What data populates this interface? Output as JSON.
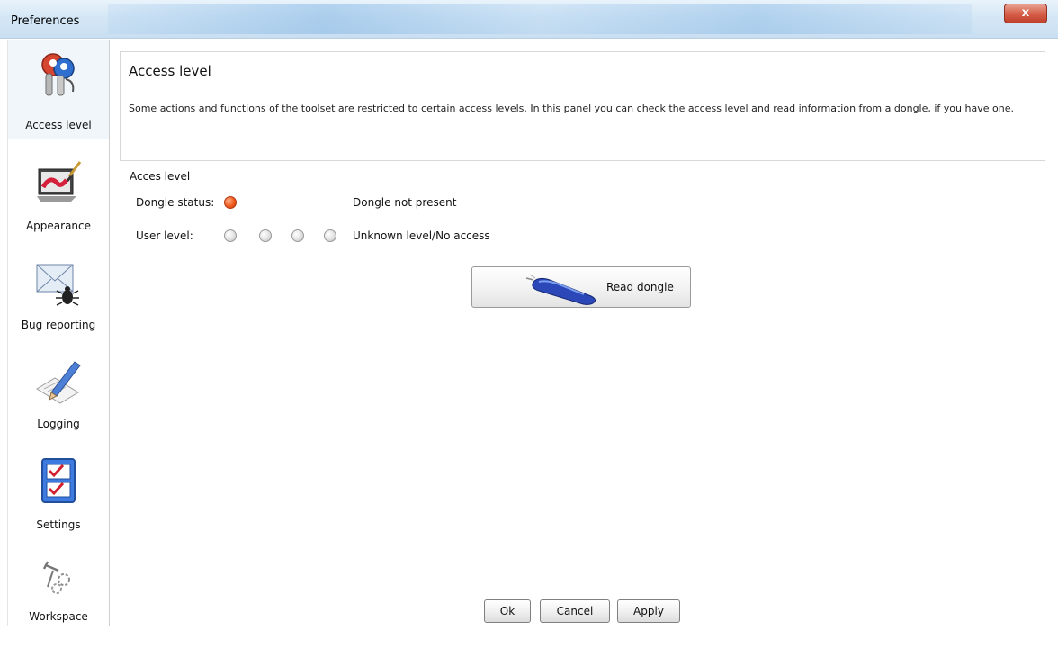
{
  "window": {
    "title": "Preferences",
    "close_label": "x"
  },
  "sidebar": {
    "items": [
      {
        "label": "Access level",
        "icon": "keys-icon"
      },
      {
        "label": "Appearance",
        "icon": "paint-monitor-icon"
      },
      {
        "label": "Bug reporting",
        "icon": "envelope-bug-icon"
      },
      {
        "label": "Logging",
        "icon": "pencil-notepad-icon"
      },
      {
        "label": "Settings",
        "icon": "checklist-icon"
      },
      {
        "label": "Workspace",
        "icon": "tools-gears-icon"
      }
    ],
    "selected_index": 0
  },
  "header": {
    "title": "Access level",
    "description": "Some actions and functions of the toolset are restricted to certain access levels. In this panel you can check the access level and read information from a dongle, if you have one."
  },
  "access": {
    "section_label": "Acces level",
    "dongle_status_label": "Dongle status:",
    "dongle_status_text": "Dongle not present",
    "dongle_status_color": "#f05a1c",
    "user_level_label": "User level:",
    "user_level_leds": 4,
    "user_level_text": "Unknown level/No access",
    "read_dongle_label": "Read dongle"
  },
  "footer": {
    "ok_label": "Ok",
    "cancel_label": "Cancel",
    "apply_label": "Apply"
  }
}
